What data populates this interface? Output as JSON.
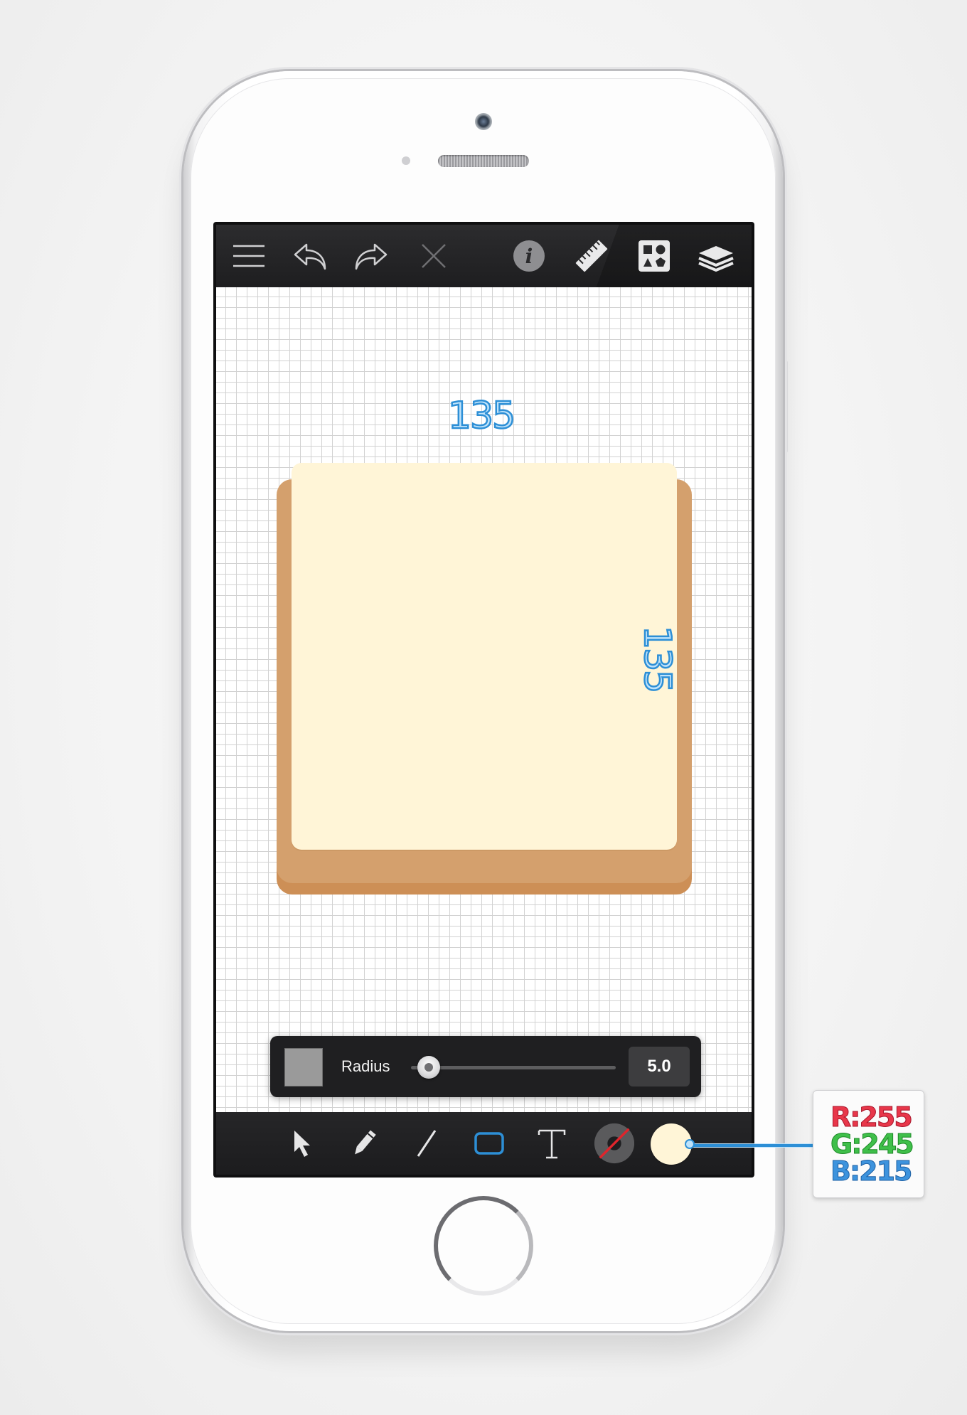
{
  "canvas": {
    "dimension_width": "135",
    "dimension_height": "135",
    "shape_fill_color": "#fff5d7",
    "shape_border_color": "#d4a06d"
  },
  "topbar": {
    "icons": [
      "menu-icon",
      "undo-icon",
      "redo-icon",
      "close-icon",
      "info-icon",
      "ruler-icon",
      "shapes-library-icon",
      "layers-icon"
    ]
  },
  "radius_panel": {
    "label": "Radius",
    "value": "5.0",
    "slider_fraction": 0.08,
    "swatch_color": "#9a9a9a"
  },
  "bottom_toolbar": {
    "tools": [
      "select-arrow-icon",
      "pencil-icon",
      "line-icon",
      "rectangle-icon",
      "text-icon",
      "stroke-color-icon",
      "fill-color-icon"
    ],
    "active_tool": "rectangle",
    "fill_color": "#fff5d7"
  },
  "color_callout": {
    "r": "R:255",
    "g": "G:245",
    "b": "B:215"
  }
}
